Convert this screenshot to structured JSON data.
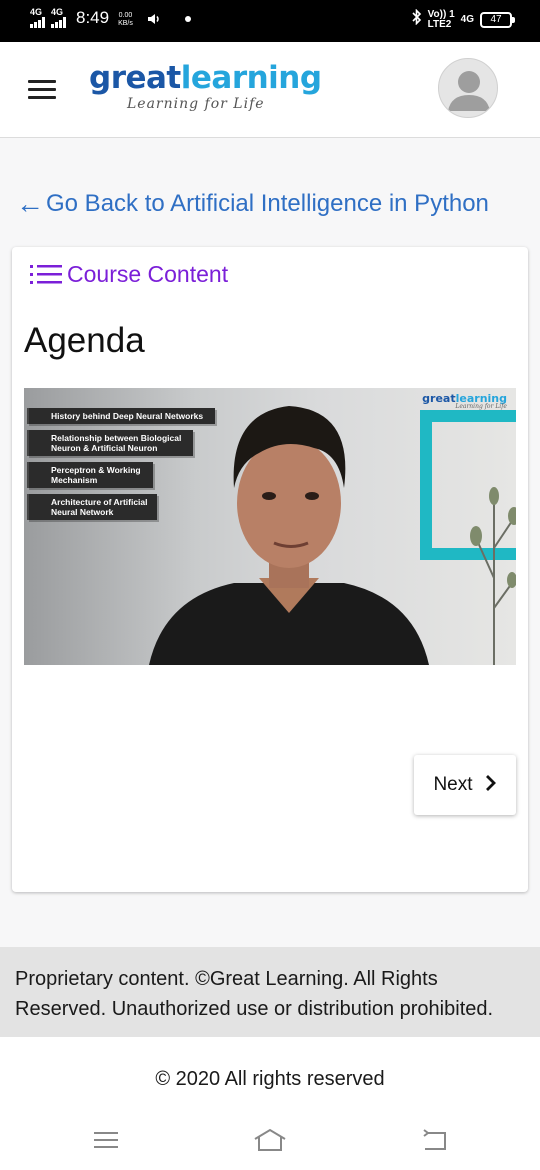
{
  "status_bar": {
    "sim1_label": "4G",
    "sim2_label": "4G",
    "time": "8:49",
    "net_speed_value": "0.00",
    "net_speed_unit": "KB/s",
    "volte_top": "Vo)) 1",
    "volte_bottom": "LTE2",
    "network_right": "4G",
    "battery": "47"
  },
  "header": {
    "logo_great": "great",
    "logo_learning": "learning",
    "tagline": "Learning for Life",
    "avatar_icon": "user-avatar-icon"
  },
  "back_link": {
    "arrow": "←",
    "text": "Go Back to Artificial Intelligence in Python"
  },
  "card": {
    "course_content_label": "Course Content",
    "title": "Agenda",
    "video": {
      "agenda_items": [
        "History behind Deep Neural Networks",
        "Relationship between Biological Neuron & Artificial Neuron",
        "Perceptron & Working Mechanism",
        "Architecture of Artificial Neural Network"
      ],
      "logo_great": "great",
      "logo_learning": "learning",
      "logo_tagline": "Learning for Life"
    },
    "next_label": "Next",
    "next_icon": "chevron-right-icon"
  },
  "footer": {
    "notice": "Proprietary content. ©Great Learning. All Rights Reserved. Unauthorized use or distribution prohibited.",
    "copyright": "© 2020 All rights reserved"
  },
  "colors": {
    "brand_dark_blue": "#1b57a6",
    "brand_light_blue": "#25a5dc",
    "link_blue": "#2f6fc4",
    "course_content_purple": "#7b1fd8"
  }
}
